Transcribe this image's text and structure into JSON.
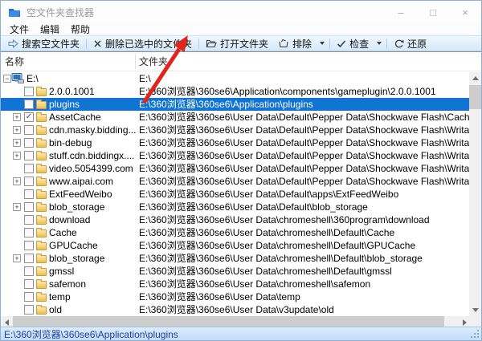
{
  "window": {
    "title": "空文件夹查找器",
    "controls": {
      "minimize": "–",
      "maximize": "□",
      "close": "×"
    }
  },
  "menu": {
    "items": [
      {
        "label": "文件"
      },
      {
        "label": "编辑"
      },
      {
        "label": "帮助"
      }
    ]
  },
  "toolbar": {
    "buttons": [
      {
        "label": "搜索空文件夹",
        "icon": "search-arrow-icon",
        "has_dropdown": false
      },
      {
        "label": "删除已选中的文件夹",
        "icon": "delete-x-icon",
        "has_dropdown": false
      },
      {
        "label": "打开文件夹",
        "icon": "open-folder-icon",
        "has_dropdown": false
      },
      {
        "label": "排除",
        "icon": "exclude-folder-icon",
        "has_dropdown": true
      },
      {
        "label": "检查",
        "icon": "check-icon",
        "has_dropdown": true
      },
      {
        "label": "还原",
        "icon": "restore-icon",
        "has_dropdown": false
      }
    ]
  },
  "list": {
    "columns": [
      {
        "label": "名称"
      },
      {
        "label": "文件夹"
      }
    ],
    "rows": [
      {
        "name": "E:\\",
        "path": "E:\\",
        "depth": 0,
        "expander": "minus",
        "checkbox": false,
        "checked": false,
        "selected": false,
        "icon": "computer"
      },
      {
        "name": "2.0.0.1001",
        "path": "E:\\360浏览器\\360se6\\Application\\components\\gameplugin\\2.0.0.1001",
        "depth": 1,
        "expander": null,
        "checkbox": true,
        "checked": false,
        "selected": false,
        "icon": "folder"
      },
      {
        "name": "plugins",
        "path": "E:\\360浏览器\\360se6\\Application\\plugins",
        "depth": 1,
        "expander": null,
        "checkbox": true,
        "checked": false,
        "selected": true,
        "icon": "folder"
      },
      {
        "name": "AssetCache",
        "path": "E:\\360浏览器\\360se6\\User Data\\Default\\Pepper Data\\Shockwave Flash\\CacheWritableA",
        "depth": 1,
        "expander": "plus",
        "checkbox": true,
        "checked": true,
        "selected": false,
        "icon": "folder"
      },
      {
        "name": "cdn.masky.bidding...",
        "path": "E:\\360浏览器\\360se6\\User Data\\Default\\Pepper Data\\Shockwave Flash\\WritableRoot\\#",
        "depth": 1,
        "expander": "plus",
        "checkbox": true,
        "checked": false,
        "selected": false,
        "icon": "folder"
      },
      {
        "name": "bin-debug",
        "path": "E:\\360浏览器\\360se6\\User Data\\Default\\Pepper Data\\Shockwave Flash\\WritableRoot\\#",
        "depth": 1,
        "expander": "plus",
        "checkbox": true,
        "checked": false,
        "selected": false,
        "icon": "folder"
      },
      {
        "name": "stuff.cdn.biddingx....",
        "path": "E:\\360浏览器\\360se6\\User Data\\Default\\Pepper Data\\Shockwave Flash\\WritableRoot\\#",
        "depth": 1,
        "expander": "plus",
        "checkbox": true,
        "checked": false,
        "selected": false,
        "icon": "folder"
      },
      {
        "name": "video.5054399.com",
        "path": "E:\\360浏览器\\360se6\\User Data\\Default\\Pepper Data\\Shockwave Flash\\WritableRoot\\#",
        "depth": 1,
        "expander": null,
        "checkbox": true,
        "checked": false,
        "selected": false,
        "icon": "folder"
      },
      {
        "name": "www.aipai.com",
        "path": "E:\\360浏览器\\360se6\\User Data\\Default\\Pepper Data\\Shockwave Flash\\WritableRoot\\#",
        "depth": 1,
        "expander": "plus",
        "checkbox": true,
        "checked": false,
        "selected": false,
        "icon": "folder"
      },
      {
        "name": "ExtFeedWeibo",
        "path": "E:\\360浏览器\\360se6\\User Data\\Default\\apps\\ExtFeedWeibo",
        "depth": 1,
        "expander": null,
        "checkbox": true,
        "checked": false,
        "selected": false,
        "icon": "folder"
      },
      {
        "name": "blob_storage",
        "path": "E:\\360浏览器\\360se6\\User Data\\Default\\blob_storage",
        "depth": 1,
        "expander": "plus",
        "checkbox": true,
        "checked": false,
        "selected": false,
        "icon": "folder"
      },
      {
        "name": "download",
        "path": "E:\\360浏览器\\360se6\\User Data\\chromeshell\\360program\\download",
        "depth": 1,
        "expander": null,
        "checkbox": true,
        "checked": false,
        "selected": false,
        "icon": "folder"
      },
      {
        "name": "Cache",
        "path": "E:\\360浏览器\\360se6\\User Data\\chromeshell\\Default\\Cache",
        "depth": 1,
        "expander": null,
        "checkbox": true,
        "checked": false,
        "selected": false,
        "icon": "folder"
      },
      {
        "name": "GPUCache",
        "path": "E:\\360浏览器\\360se6\\User Data\\chromeshell\\Default\\GPUCache",
        "depth": 1,
        "expander": null,
        "checkbox": true,
        "checked": false,
        "selected": false,
        "icon": "folder"
      },
      {
        "name": "blob_storage",
        "path": "E:\\360浏览器\\360se6\\User Data\\chromeshell\\Default\\blob_storage",
        "depth": 1,
        "expander": "plus",
        "checkbox": true,
        "checked": false,
        "selected": false,
        "icon": "folder"
      },
      {
        "name": "gmssl",
        "path": "E:\\360浏览器\\360se6\\User Data\\chromeshell\\Default\\gmssl",
        "depth": 1,
        "expander": null,
        "checkbox": true,
        "checked": false,
        "selected": false,
        "icon": "folder"
      },
      {
        "name": "safemon",
        "path": "E:\\360浏览器\\360se6\\User Data\\chromeshell\\safemon",
        "depth": 1,
        "expander": null,
        "checkbox": true,
        "checked": false,
        "selected": false,
        "icon": "folder"
      },
      {
        "name": "temp",
        "path": "E:\\360浏览器\\360se6\\User Data\\temp",
        "depth": 1,
        "expander": null,
        "checkbox": true,
        "checked": false,
        "selected": false,
        "icon": "folder"
      },
      {
        "name": "old",
        "path": "E:\\360浏览器\\360se6\\User Data\\v3update\\old",
        "depth": 1,
        "expander": null,
        "checkbox": true,
        "checked": false,
        "selected": false,
        "icon": "folder"
      }
    ]
  },
  "statusbar": {
    "text": "E:\\360浏览器\\360se6\\Application\\plugins"
  },
  "annotation": {
    "type": "red-arrow",
    "color": "#e2251a"
  },
  "colors": {
    "selection": "#1173d4",
    "folder": "#f0c155",
    "toolbar_bg": "#d7e9f9",
    "status_text": "#1d3faa"
  }
}
